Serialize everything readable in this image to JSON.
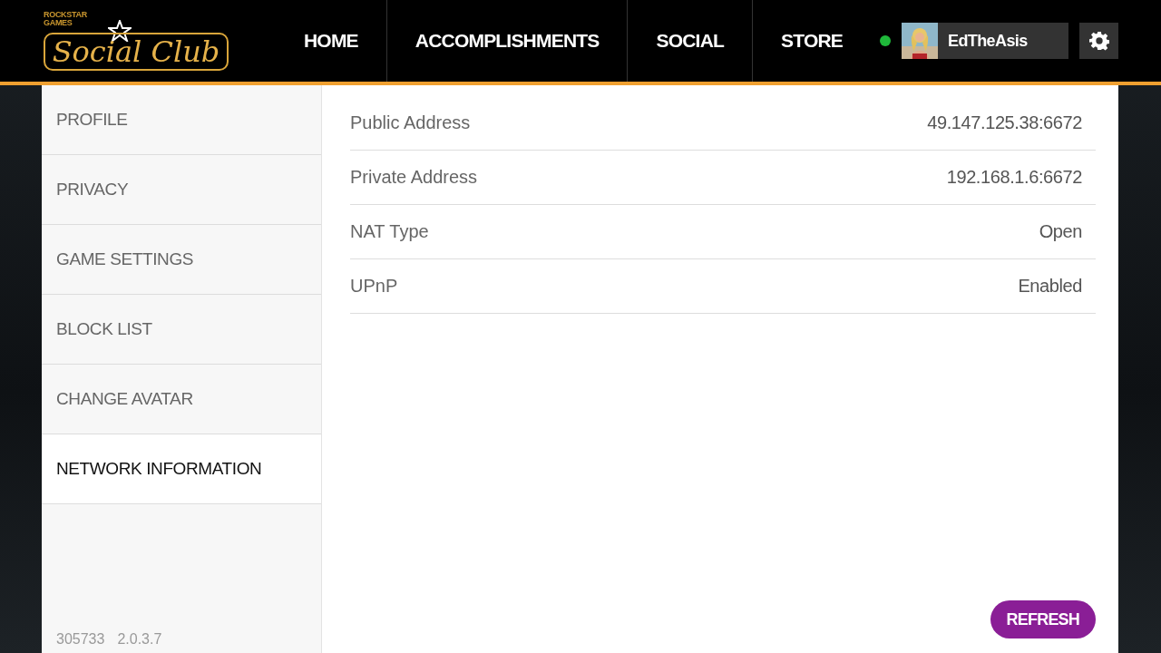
{
  "logo": {
    "publisher": "ROCKSTAR GAMES",
    "name": "Social Club"
  },
  "nav": [
    {
      "label": "HOME",
      "selected": false
    },
    {
      "label": "ACCOMPLISHMENTS",
      "selected": false
    },
    {
      "label": "SOCIAL",
      "selected": false
    },
    {
      "label": "STORE",
      "selected": false
    }
  ],
  "user": {
    "online": true,
    "name": "EdTheAsis"
  },
  "sidebar": {
    "items": [
      {
        "label": "PROFILE",
        "selected": false
      },
      {
        "label": "PRIVACY",
        "selected": false
      },
      {
        "label": "GAME SETTINGS",
        "selected": false
      },
      {
        "label": "BLOCK LIST",
        "selected": false
      },
      {
        "label": "CHANGE AVATAR",
        "selected": false
      },
      {
        "label": "NETWORK INFORMATION",
        "selected": true
      }
    ],
    "build": "305733",
    "version": "2.0.3.7"
  },
  "network": [
    {
      "label": "Public Address",
      "value": "49.147.125.38:6672"
    },
    {
      "label": "Private Address",
      "value": "192.168.1.6:6672"
    },
    {
      "label": "NAT Type",
      "value": "Open"
    },
    {
      "label": "UPnP",
      "value": "Enabled"
    }
  ],
  "refresh_button": "REFRESH"
}
